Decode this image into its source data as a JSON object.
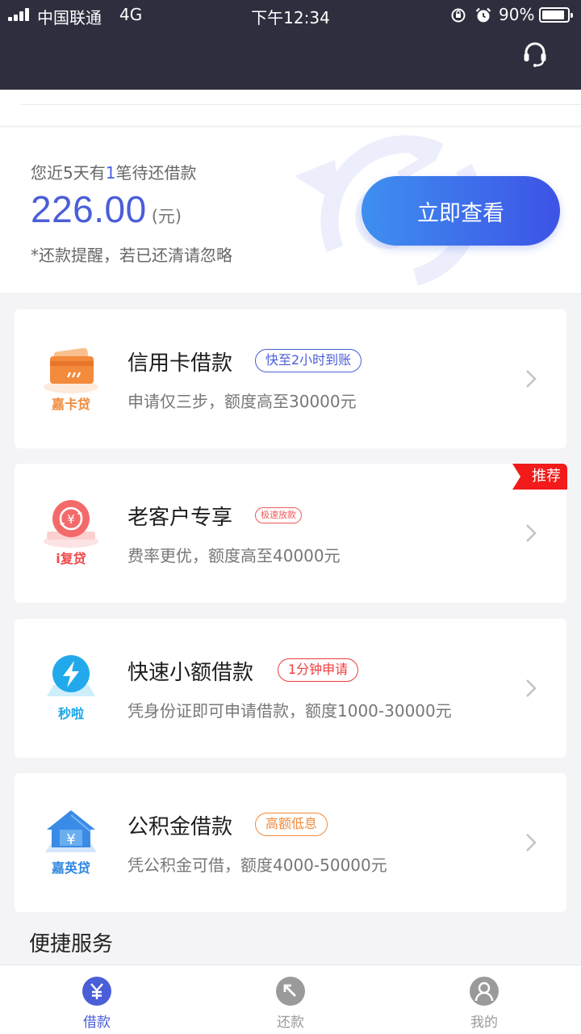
{
  "status_bar": {
    "carrier": "中国联通",
    "network": "4G",
    "time": "下午12:34",
    "battery": "90%",
    "battery_level": 0.9
  },
  "header": {
    "icon": "headset-icon"
  },
  "reminder": {
    "text_before": "您近5天有",
    "count": "1",
    "text_after": "笔待还借款",
    "amount": "226.00",
    "unit": "(元)",
    "note": "*还款提醒，若已还清请忽略",
    "button": "立即查看"
  },
  "products": [
    {
      "brand": "嘉卡贷",
      "title": "信用卡借款",
      "tag": "快至2小时到账",
      "desc": "申请仅三步，额度高至30000元",
      "tag_color": "#4a5ed8",
      "brand_color": "#f08a3c",
      "icon": "credit-card-icon"
    },
    {
      "brand": "i复贷",
      "title": "老客户专享",
      "tag": "极速放款",
      "desc": "费率更优，额度高至40000元",
      "tag_color": "#f25a5a",
      "brand_color": "#f04848",
      "icon": "yuan-cycle-icon",
      "ribbon": "推荐"
    },
    {
      "brand": "秒啦",
      "title": "快速小额借款",
      "tag": "1分钟申请",
      "desc": "凭身份证即可申请借款，额度1000-30000元",
      "tag_color": "#f03c3c",
      "brand_color": "#1ea6e8",
      "icon": "lightning-icon"
    },
    {
      "brand": "嘉英贷",
      "title": "公积金借款",
      "tag": "高额低息",
      "desc": "凭公积金可借，额度4000-50000元",
      "tag_color": "#f08a3c",
      "brand_color": "#2c86e0",
      "icon": "house-yuan-icon"
    }
  ],
  "section_title": "便捷服务",
  "tabs": [
    {
      "label": "借款",
      "active": true,
      "icon": "yuan-icon"
    },
    {
      "label": "还款",
      "active": false,
      "icon": "return-arrow-icon"
    },
    {
      "label": "我的",
      "active": false,
      "icon": "user-icon"
    }
  ],
  "colors": {
    "header_bg": "#2d2f3e",
    "accent": "#4a5ed8",
    "tab_active": "#4a5ed8",
    "tab_inactive": "#9a9a9a"
  }
}
